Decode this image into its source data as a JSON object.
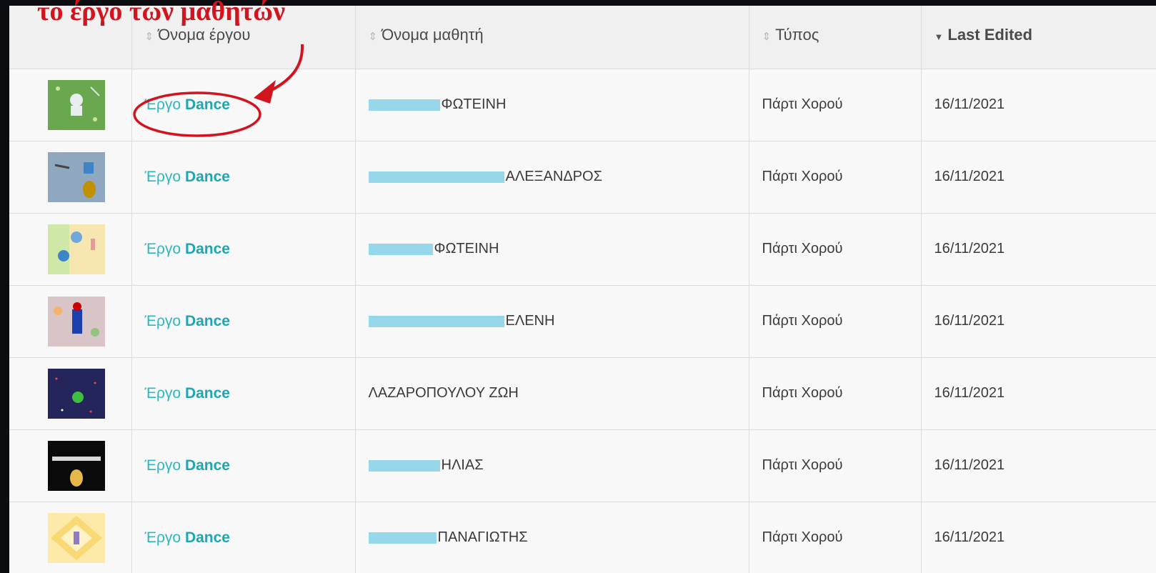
{
  "annotation": {
    "text": "το έργο των μαθητών",
    "color": "#d2141e"
  },
  "table": {
    "headers": {
      "project_name": "Όνομα έργου",
      "student_name": "Όνομα μαθητή",
      "type": "Τύπος",
      "last_edited": "Last Edited"
    },
    "sort": {
      "column": "Last Edited",
      "direction": "descending"
    },
    "rows": [
      {
        "thumbnail": "dance-thumbnail-green-robot",
        "project_prefix": "Έργο",
        "project_suffix": "Dance",
        "student_name": "ΦΩΤΕΙΝΗ",
        "student_name_redacted": true,
        "type": "Πάρτι Χορού",
        "last_edited": "16/11/2021"
      },
      {
        "thumbnail": "dance-thumbnail-blue-dancers",
        "project_prefix": "Έργο",
        "project_suffix": "Dance",
        "student_name": "ΑΛΕΞΑΝΔΡΟΣ",
        "student_name_redacted": true,
        "type": "Πάρτι Χορού",
        "last_edited": "16/11/2021"
      },
      {
        "thumbnail": "dance-thumbnail-rainbow",
        "project_prefix": "Έργο",
        "project_suffix": "Dance",
        "student_name": "ΦΩΤΕΙΝΗ",
        "student_name_redacted": true,
        "type": "Πάρτι Χορού",
        "last_edited": "16/11/2021"
      },
      {
        "thumbnail": "dance-thumbnail-colorful",
        "project_prefix": "Έργο",
        "project_suffix": "Dance",
        "student_name": "ΕΛΕΝΗ",
        "student_name_redacted": true,
        "type": "Πάρτι Χορού",
        "last_edited": "16/11/2021"
      },
      {
        "thumbnail": "dance-thumbnail-dark-space",
        "project_prefix": "Έργο",
        "project_suffix": "Dance",
        "student_name": "ΛΑΖΑΡΟΠΟΥΛΟΥ ΖΩΗ",
        "student_name_redacted": false,
        "type": "Πάρτι Χορού",
        "last_edited": "16/11/2021"
      },
      {
        "thumbnail": "dance-thumbnail-black-stage",
        "project_prefix": "Έργο",
        "project_suffix": "Dance",
        "student_name": "ΗΛΙΑΣ",
        "student_name_redacted": true,
        "type": "Πάρτι Χορού",
        "last_edited": "16/11/2021"
      },
      {
        "thumbnail": "dance-thumbnail-yellow-diamond",
        "project_prefix": "Έργο",
        "project_suffix": "Dance",
        "student_name": "ΠΑΝΑΓΙΩΤΗΣ",
        "student_name_redacted": true,
        "type": "Πάρτι Χορού",
        "last_edited": "16/11/2021"
      }
    ]
  },
  "colors": {
    "link": "#2bb6c4",
    "redaction": "#96d8ea",
    "background": "#0b0d11"
  }
}
